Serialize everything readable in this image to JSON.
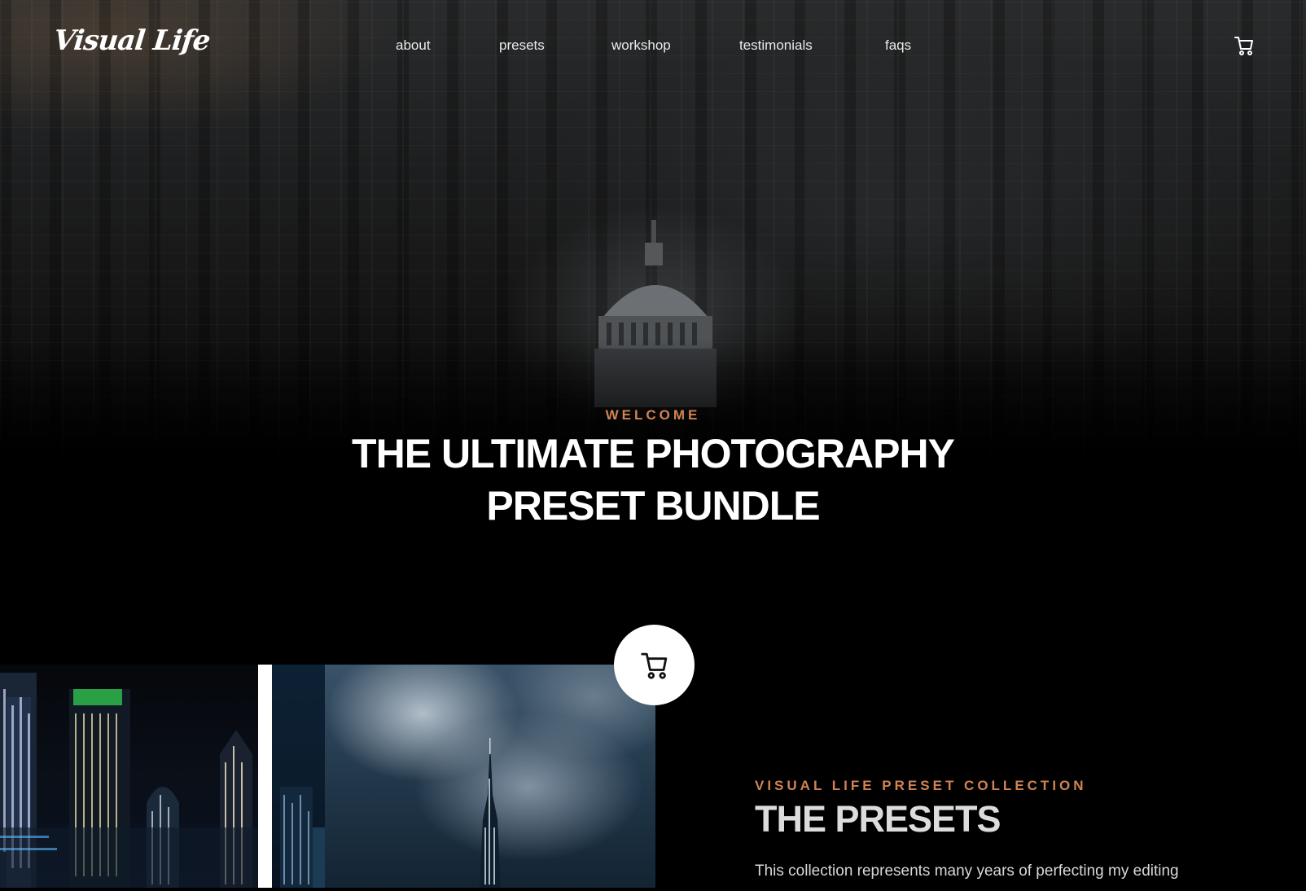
{
  "brand": {
    "logo_text": "Visual Life"
  },
  "nav": {
    "items": [
      {
        "label": "about"
      },
      {
        "label": "presets"
      },
      {
        "label": "workshop"
      },
      {
        "label": "testimonials"
      },
      {
        "label": "faqs"
      }
    ],
    "cart_icon": "cart-icon"
  },
  "hero": {
    "eyebrow": "WELCOME",
    "headline_line1": "THE ULTIMATE PHOTOGRAPHY",
    "headline_line2": "PRESET BUNDLE"
  },
  "presets_section": {
    "eyebrow": "VISUAL LIFE PRESET COLLECTION",
    "title": "THE PRESETS",
    "text": "This collection represents many years of perfecting my editing",
    "cart_button_icon": "cart-icon"
  },
  "colors": {
    "accent": "#d08353",
    "background": "#000000",
    "text": "#ffffff"
  }
}
